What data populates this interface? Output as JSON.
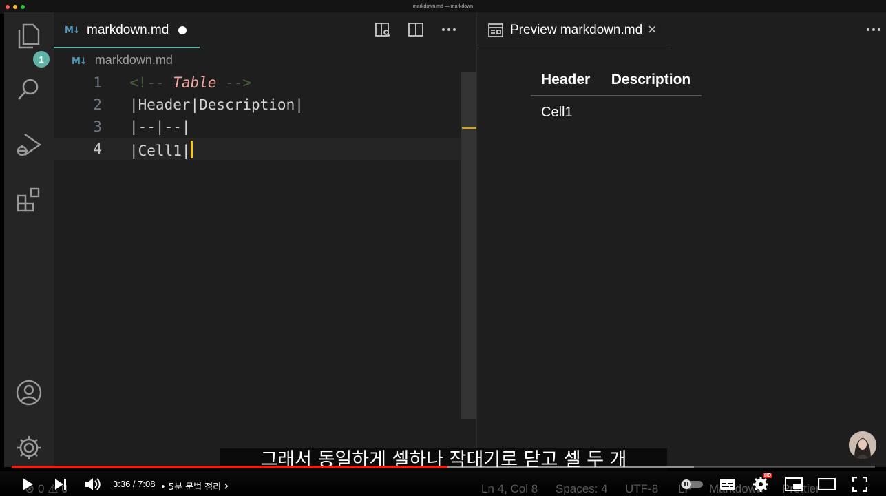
{
  "window": {
    "title": "markdown.md — markdown"
  },
  "activity_bar": {
    "explorer_badge": "1"
  },
  "editor": {
    "tab_label": "markdown.md",
    "tab_icon": "M↓",
    "breadcrumb": "markdown.md",
    "lines": [
      {
        "number": "1",
        "comment_open": "<!-- ",
        "comment_word": "Table",
        "comment_close": " -->"
      },
      {
        "number": "2",
        "text": "|Header|Description|"
      },
      {
        "number": "3",
        "text": "|--|--|"
      },
      {
        "number": "4",
        "text": "|Cell1|"
      }
    ]
  },
  "preview": {
    "tab_label": "Preview markdown.md",
    "close_glyph": "×",
    "table": {
      "headers": [
        "Header",
        "Description"
      ],
      "rows": [
        [
          "Cell1",
          ""
        ]
      ]
    }
  },
  "video": {
    "subtitle": "그래서 동일하게 셀하나 작대기로 닫고 셀 두 개",
    "time": "3:36 / 7:08",
    "chapter": "• 5분 문법 정리",
    "chapter_chevron": "›",
    "progress_played": 0.505,
    "progress_loaded": 0.79,
    "hd_badge": "HD"
  },
  "status_bar_faint": {
    "problems": "⊗ 0 ⚠ 0",
    "position": "Ln 4, Col 8",
    "spaces": "Spaces: 4",
    "encoding": "UTF-8",
    "eol": "LF",
    "language": "Markdown",
    "formatter": "Prettier"
  },
  "colors": {
    "accent_teal": "#5fb3a7",
    "progress_red": "#e62117",
    "cursor_yellow": "#f5c518",
    "md_icon_blue": "#519aba"
  }
}
